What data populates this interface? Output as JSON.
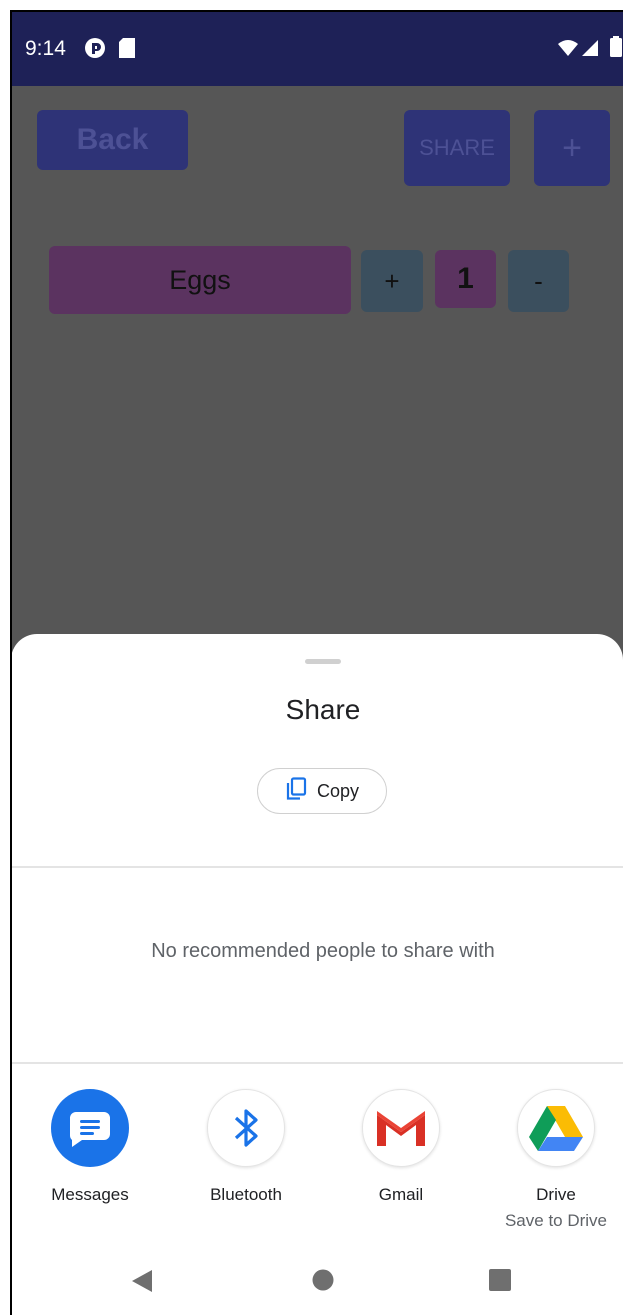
{
  "status_bar": {
    "time": "9:14"
  },
  "app": {
    "back_label": "Back",
    "share_label": "SHARE",
    "add_label": "+",
    "item": {
      "name": "Eggs",
      "increment_label": "+",
      "quantity": "1",
      "decrement_label": "-"
    }
  },
  "share_sheet": {
    "title": "Share",
    "copy_label": "Copy",
    "no_people_text": "No recommended people to share with",
    "apps": [
      {
        "label": "Messages",
        "icon": "messages-icon"
      },
      {
        "label": "Bluetooth",
        "icon": "bluetooth-icon"
      },
      {
        "label": "Gmail",
        "icon": "gmail-icon"
      },
      {
        "label": "Drive",
        "sublabel": "Save to Drive",
        "icon": "drive-icon"
      }
    ]
  },
  "colors": {
    "status_bar": "#1e2157",
    "scrim_background": "#565656",
    "dim_button": "#2e3377",
    "item_name_bg": "#5b3360",
    "item_stepper_bg": "#3b4f5e",
    "messages_blue": "#1a73e8"
  }
}
